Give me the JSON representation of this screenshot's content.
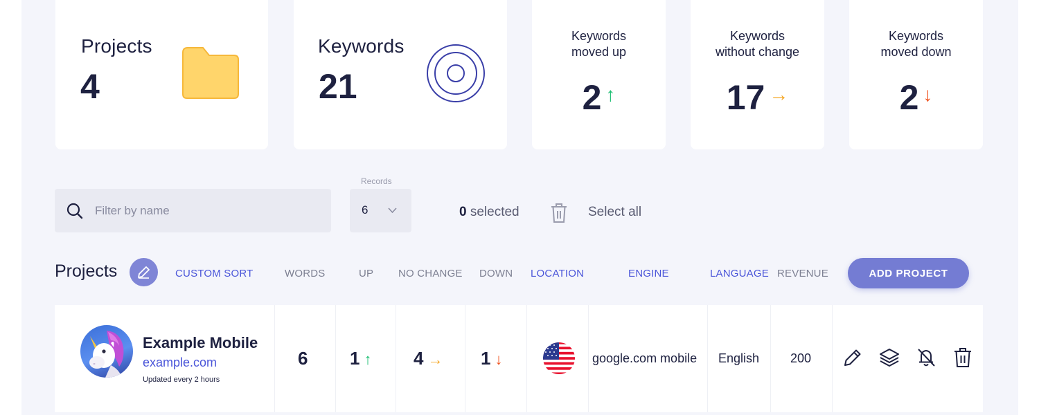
{
  "stats": {
    "projects": {
      "title": "Projects",
      "value": "4",
      "icon": "folder-icon"
    },
    "keywords": {
      "title": "Keywords",
      "value": "21",
      "icon": "target-icon"
    },
    "moved_up": {
      "title_line1": "Keywords",
      "title_line2": "moved up",
      "value": "2",
      "arrow": "↑"
    },
    "no_change": {
      "title_line1": "Keywords",
      "title_line2": "without change",
      "value": "17",
      "arrow": "→"
    },
    "moved_down": {
      "title_line1": "Keywords",
      "title_line2": "moved down",
      "value": "2",
      "arrow": "↓"
    }
  },
  "toolbar": {
    "search_placeholder": "Filter by name",
    "records_label": "Records",
    "records_value": "6",
    "selected_count": "0",
    "selected_label": "selected",
    "select_all": "Select all"
  },
  "table": {
    "title": "Projects",
    "headers": {
      "custom_sort": "CUSTOM SORT",
      "words": "WORDS",
      "up": "UP",
      "no_change": "NO CHANGE",
      "down": "DOWN",
      "location": "LOCATION",
      "engine": "ENGINE",
      "language": "LANGUAGE",
      "revenue": "REVENUE"
    },
    "add_button": "ADD PROJECT",
    "rows": [
      {
        "name": "Example Mobile",
        "domain": "example.com",
        "updated": "Updated every 2 hours",
        "words": "6",
        "up": "1",
        "up_arrow": "↑",
        "no_change": "4",
        "no_change_arrow": "→",
        "down": "1",
        "down_arrow": "↓",
        "location_flag": "us-flag-icon",
        "engine": "google.com mobile",
        "language": "English",
        "revenue": "200"
      }
    ]
  },
  "colors": {
    "accent": "#4a55d9",
    "button": "#747cd3",
    "up": "#1fbf74",
    "no_change": "#f5a623",
    "down": "#f0521e",
    "background": "#f4f5fb"
  }
}
